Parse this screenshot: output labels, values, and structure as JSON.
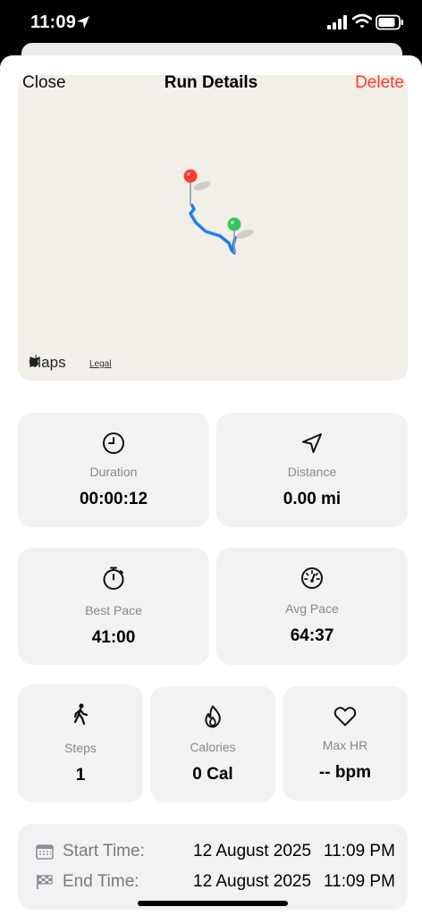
{
  "status_bar": {
    "time": "11:09"
  },
  "nav": {
    "close": "Close",
    "title": "Run Details",
    "delete": "Delete"
  },
  "map": {
    "brand": "Maps",
    "legal": "Legal"
  },
  "stats": {
    "duration": {
      "label": "Duration",
      "value": "00:00:12"
    },
    "distance": {
      "label": "Distance",
      "value": "0.00 mi"
    },
    "best_pace": {
      "label": "Best Pace",
      "value": "41:00"
    },
    "avg_pace": {
      "label": "Avg Pace",
      "value": "64:37"
    },
    "steps": {
      "label": "Steps",
      "value": "1"
    },
    "calories": {
      "label": "Calories",
      "value": "0 Cal"
    },
    "max_hr": {
      "label": "Max HR",
      "value": "-- bpm"
    }
  },
  "times": {
    "start": {
      "label": "Start Time:",
      "date": "12 August 2025",
      "time": "11:09 PM"
    },
    "end": {
      "label": "End Time:",
      "date": "12 August 2025",
      "time": "11:09 PM"
    }
  },
  "colors": {
    "delete": "#ff3b30",
    "route": "#1e7cf2",
    "start_pin": "#34c759",
    "end_pin": "#ff3b30"
  },
  "icons": [
    "clock-icon",
    "location-arrow-icon",
    "stopwatch-icon",
    "gauge-icon",
    "walking-icon",
    "flame-icon",
    "heart-icon",
    "calendar-icon",
    "checkered-flag-icon"
  ]
}
